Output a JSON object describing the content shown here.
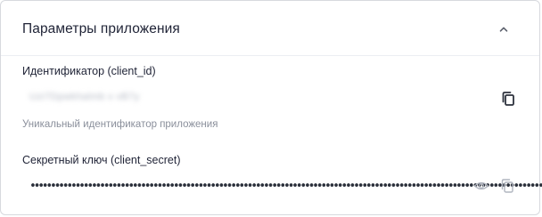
{
  "section": {
    "title": "Параметры приложения",
    "collapse_icon": "chevron-up-icon"
  },
  "client_id": {
    "label": "Идентификатор (client_id)",
    "value": "Uzi7Dpwkhalmb x vB7y",
    "hint": "Уникальный идентификатор приложения",
    "copy_icon": "copy-icon"
  },
  "client_secret": {
    "label": "Секретный ключ (client_secret)",
    "masked_value": "••••••••••••••••••••••••••••••••••••••••••••••••••••••••••••••••••••••••••••••••••••••••••••••••••••••••••••••••••••••••••••••••••",
    "show_icon": "eye-icon",
    "copy_icon": "copy-icon"
  }
}
